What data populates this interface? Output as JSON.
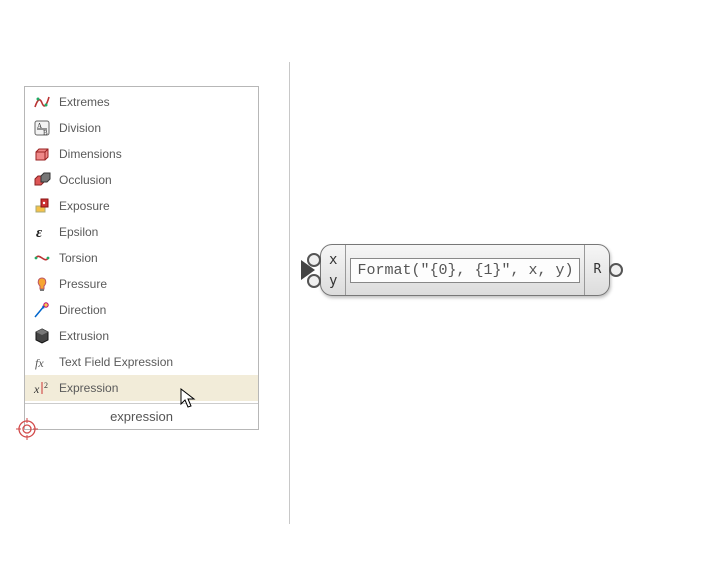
{
  "menu": {
    "items": [
      {
        "label": "Extremes",
        "icon": "extremes-icon"
      },
      {
        "label": "Division",
        "icon": "division-icon"
      },
      {
        "label": "Dimensions",
        "icon": "dimensions-icon"
      },
      {
        "label": "Occlusion",
        "icon": "occlusion-icon"
      },
      {
        "label": "Exposure",
        "icon": "exposure-icon"
      },
      {
        "label": "Epsilon",
        "icon": "epsilon-icon"
      },
      {
        "label": "Torsion",
        "icon": "torsion-icon"
      },
      {
        "label": "Pressure",
        "icon": "pressure-icon"
      },
      {
        "label": "Direction",
        "icon": "direction-icon"
      },
      {
        "label": "Extrusion",
        "icon": "extrusion-icon"
      },
      {
        "label": "Text Field Expression",
        "icon": "fx-icon"
      },
      {
        "label": "Expression",
        "icon": "xsq-icon",
        "selected": true
      }
    ],
    "search_text": "expression"
  },
  "node": {
    "inputs": [
      "x",
      "y"
    ],
    "outputs": [
      "R"
    ],
    "expression": "Format(\"{0}, {1}\", x, y)"
  }
}
